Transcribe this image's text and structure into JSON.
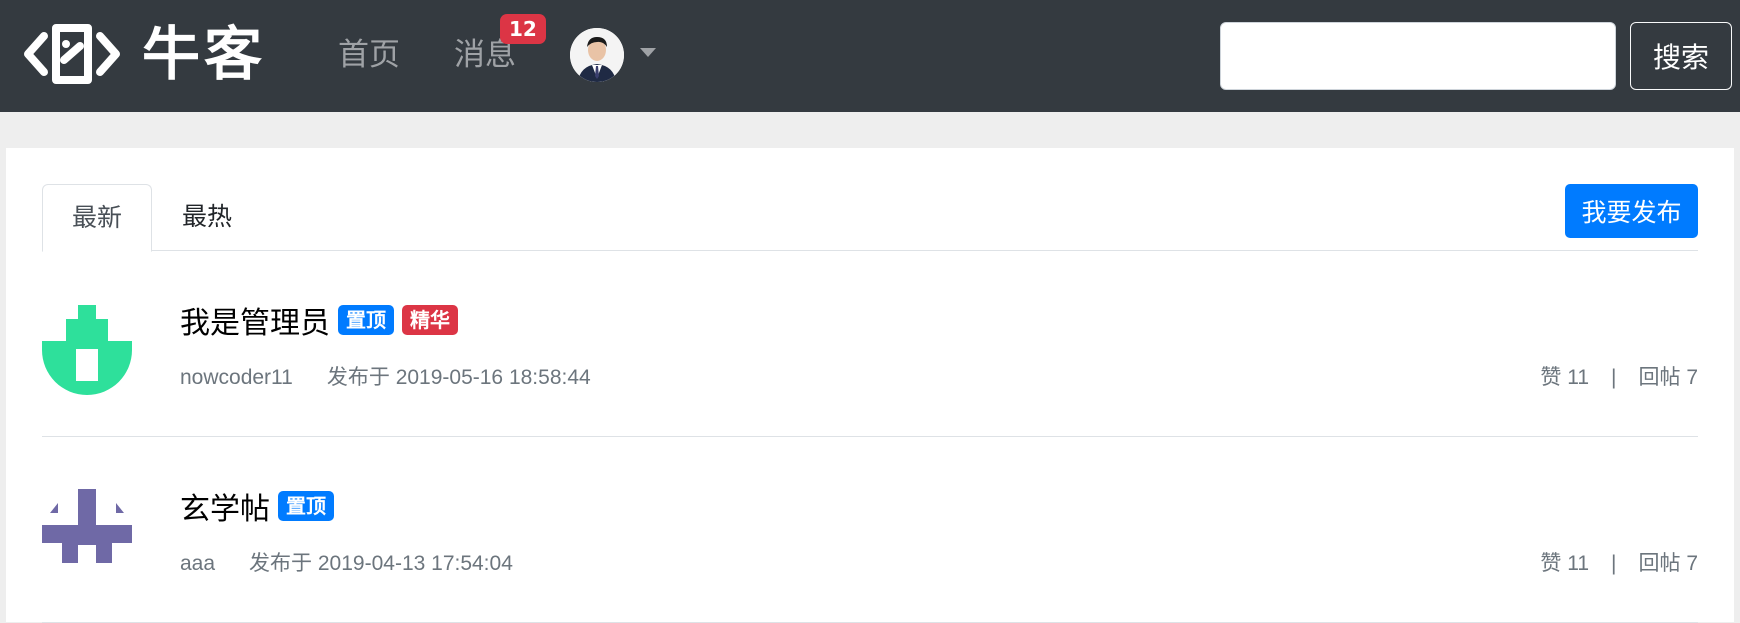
{
  "header": {
    "logo_text": "牛客",
    "nav": {
      "home_label": "首页",
      "messages_label": "消息",
      "message_count": "12"
    },
    "user_avatar": "user-avatar-photo",
    "search": {
      "value": "",
      "placeholder": "",
      "button_label": "搜索"
    }
  },
  "tabs": [
    {
      "label": "最新",
      "active": true
    },
    {
      "label": "最热",
      "active": false
    }
  ],
  "publish_button_label": "我要发布",
  "posts": [
    {
      "title": "我是管理员",
      "tags": [
        "置顶",
        "精华"
      ],
      "author": "nowcoder11",
      "published": "发布于 2019-05-16 18:58:44",
      "likes": "赞 11",
      "separator": "|",
      "replies": "回帖 7",
      "avatar_color": "#2ee09b"
    },
    {
      "title": "玄学帖",
      "tags": [
        "置顶"
      ],
      "author": "aaa",
      "published": "发布于 2019-04-13 17:54:04",
      "likes": "赞 11",
      "separator": "|",
      "replies": "回帖 7",
      "avatar_color": "#6f69a6"
    }
  ],
  "colors": {
    "header_bg": "#343a40",
    "primary": "#007bff",
    "danger": "#dc3545",
    "muted": "#6c757d"
  }
}
